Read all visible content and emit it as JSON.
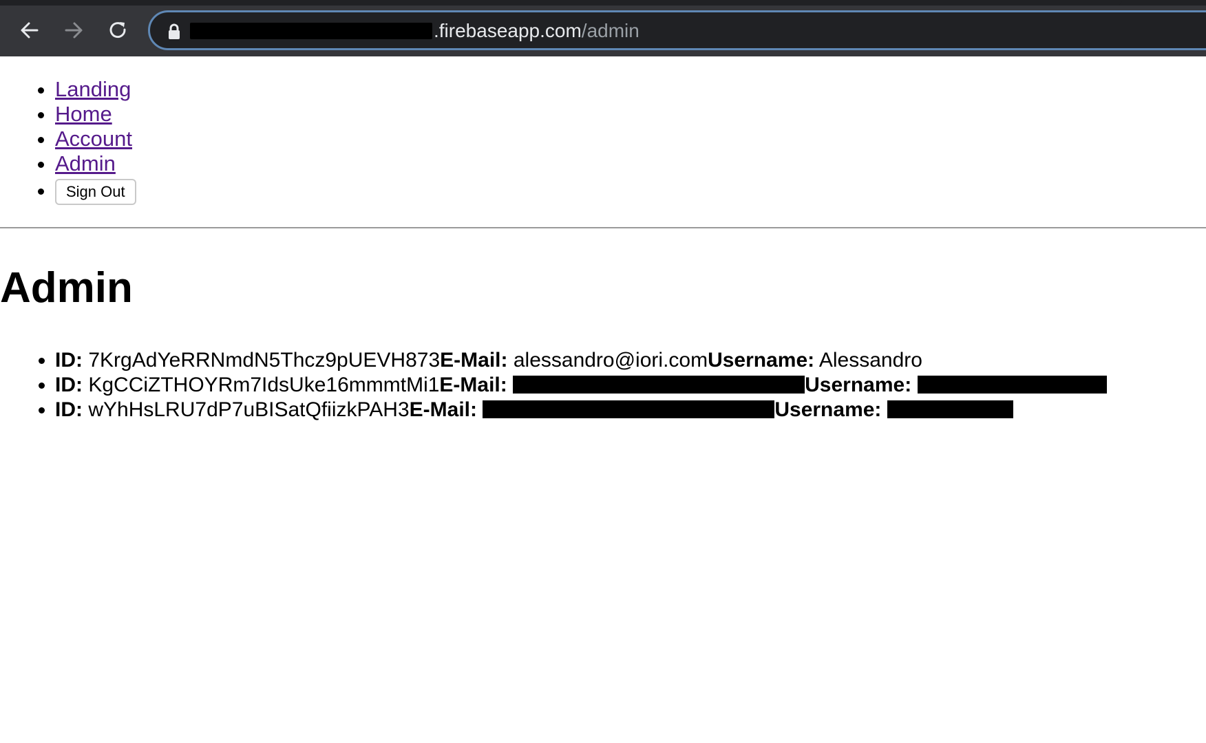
{
  "browser": {
    "url_host": ".firebaseapp.com",
    "url_path": "/admin"
  },
  "nav": {
    "links": [
      "Landing",
      "Home",
      "Account",
      "Admin"
    ],
    "sign_out_label": "Sign Out"
  },
  "main": {
    "title": "Admin",
    "id_label": "ID:",
    "email_label": "E-Mail:",
    "username_label": "Username:",
    "users": [
      {
        "id": "7KrgAdYeRRNmdN5Thcz9pUEVH873",
        "email": "alessandro@iori.com",
        "username": "Alessandro"
      },
      {
        "id": "KgCCiZTHOYRm7IdsUke16mmmtMi1",
        "email": "",
        "username": ""
      },
      {
        "id": "wYhHsLRU7dP7uBISatQfiizkPAH3",
        "email": "",
        "username": ""
      }
    ]
  },
  "colors": {
    "link": "#551a8b",
    "chrome_bg": "#35363a",
    "omnibox_border": "#5f88b5"
  }
}
